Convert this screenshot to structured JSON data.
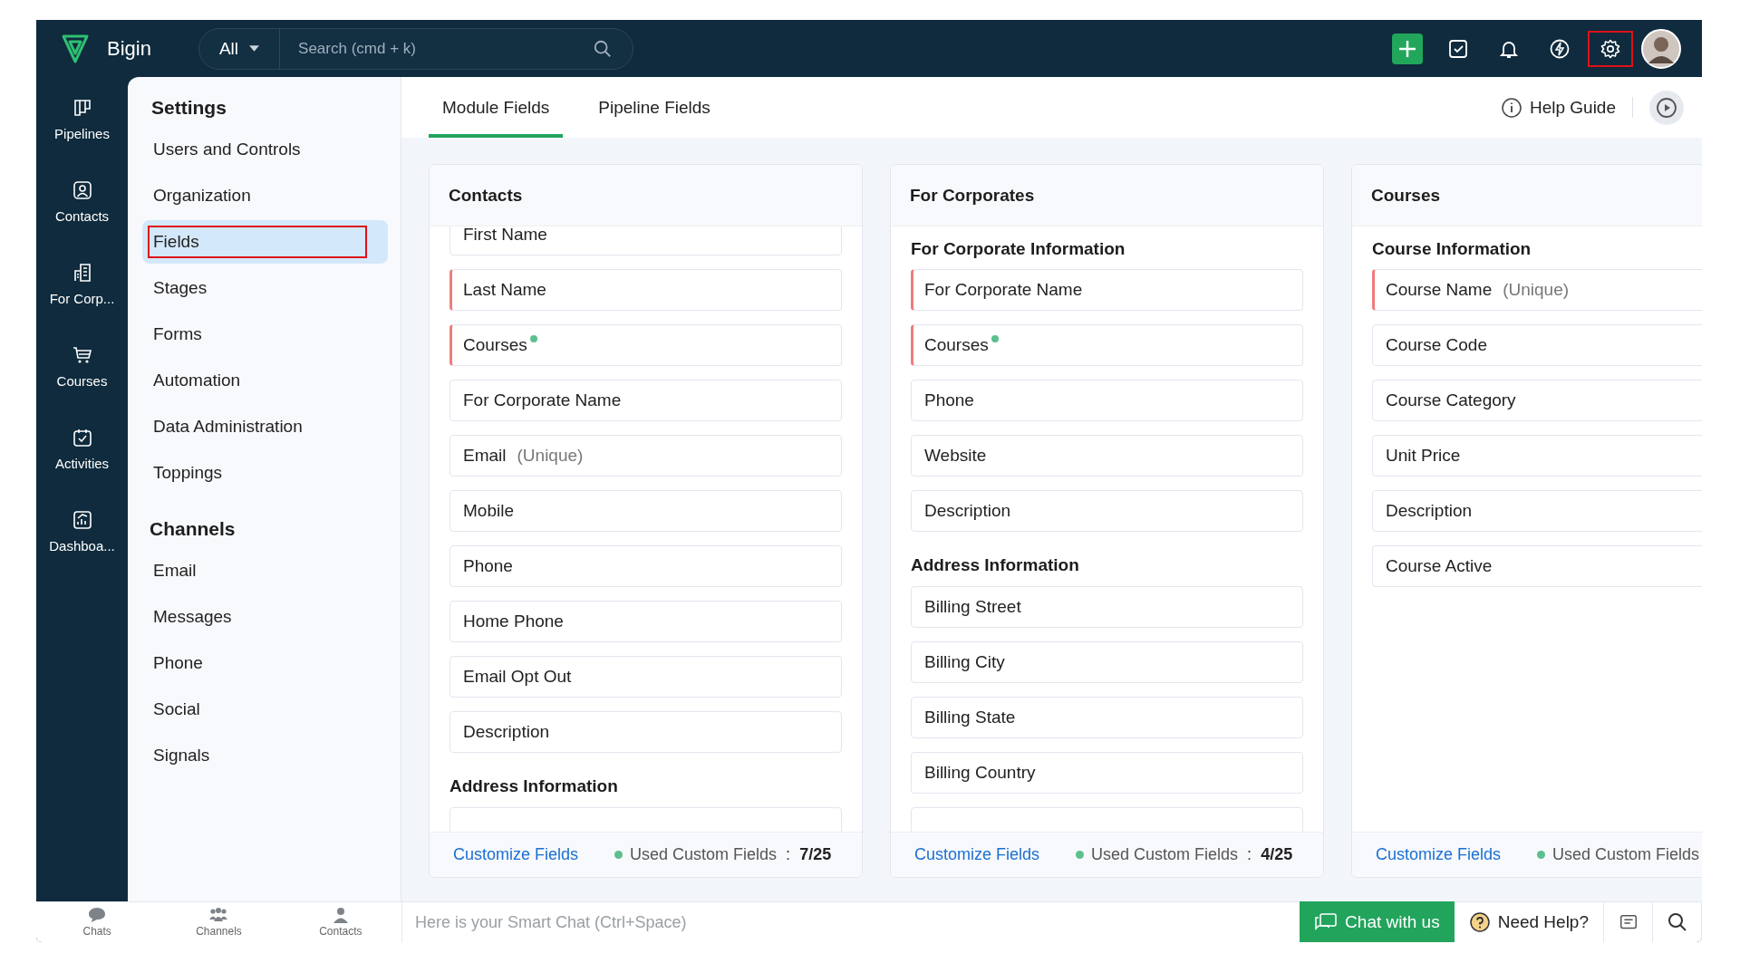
{
  "app": {
    "name": "Bigin"
  },
  "search": {
    "scope": "All",
    "placeholder": "Search (cmd + k)"
  },
  "toolbar": [
    {
      "kind": "add",
      "highlighted": false
    },
    {
      "kind": "tasks",
      "highlighted": false
    },
    {
      "kind": "notifications",
      "highlighted": false
    },
    {
      "kind": "signals",
      "highlighted": false
    },
    {
      "kind": "settings",
      "highlighted": true
    },
    {
      "kind": "avatar",
      "highlighted": false
    }
  ],
  "nav": [
    {
      "kind": "pipelines",
      "label": "Pipelines"
    },
    {
      "kind": "contacts",
      "label": "Contacts"
    },
    {
      "kind": "company",
      "label": "For Corp..."
    },
    {
      "kind": "cart",
      "label": "Courses"
    },
    {
      "kind": "activities",
      "label": "Activities"
    },
    {
      "kind": "dashboard",
      "label": "Dashboa..."
    }
  ],
  "settings": [
    {
      "title": "Settings",
      "items": [
        {
          "label": "Users and Controls",
          "selected": false,
          "highlighted": false
        },
        {
          "label": "Organization",
          "selected": false,
          "highlighted": false
        },
        {
          "label": "Fields",
          "selected": true,
          "highlighted": true
        },
        {
          "label": "Stages",
          "selected": false,
          "highlighted": false
        },
        {
          "label": "Forms",
          "selected": false,
          "highlighted": false
        },
        {
          "label": "Automation",
          "selected": false,
          "highlighted": false
        },
        {
          "label": "Data Administration",
          "selected": false,
          "highlighted": false
        },
        {
          "label": "Toppings",
          "selected": false,
          "highlighted": false
        }
      ]
    },
    {
      "title": "Channels",
      "items": [
        {
          "label": "Email",
          "selected": false,
          "highlighted": false
        },
        {
          "label": "Messages",
          "selected": false,
          "highlighted": false
        },
        {
          "label": "Phone",
          "selected": false,
          "highlighted": false
        },
        {
          "label": "Social",
          "selected": false,
          "highlighted": false
        },
        {
          "label": "Signals",
          "selected": false,
          "highlighted": false
        }
      ]
    }
  ],
  "tabs": [
    {
      "label": "Module Fields",
      "selected": true
    },
    {
      "label": "Pipeline Fields",
      "selected": false
    }
  ],
  "help_guide": "Help Guide",
  "modules": [
    {
      "title": "Contacts",
      "scrolled": true,
      "customize": "Customize Fields",
      "used_label": "Used Custom Fields",
      "used_separator": ":",
      "used_count": "7/25",
      "items": [
        {
          "kind": "field",
          "label": "First Name",
          "required": false,
          "lookup": false
        },
        {
          "kind": "field",
          "label": "Last Name",
          "required": true,
          "lookup": false
        },
        {
          "kind": "field",
          "label": "Courses",
          "required": true,
          "lookup": true
        },
        {
          "kind": "field",
          "label": "For Corporate Name",
          "required": false,
          "lookup": false
        },
        {
          "kind": "field",
          "label": "Email",
          "note": "(Unique)",
          "required": false,
          "lookup": false
        },
        {
          "kind": "field",
          "label": "Mobile",
          "required": false,
          "lookup": false
        },
        {
          "kind": "field",
          "label": "Phone",
          "required": false,
          "lookup": false
        },
        {
          "kind": "field",
          "label": "Home Phone",
          "required": false,
          "lookup": false
        },
        {
          "kind": "field",
          "label": "Email Opt Out",
          "required": false,
          "lookup": false
        },
        {
          "kind": "field",
          "label": "Description",
          "required": false,
          "lookup": false
        },
        {
          "kind": "section",
          "label": "Address Information"
        },
        {
          "kind": "cut"
        }
      ]
    },
    {
      "title": "For Corporates",
      "scrolled": false,
      "customize": "Customize Fields",
      "used_label": "Used Custom Fields",
      "used_separator": ":",
      "used_count": "4/25",
      "items": [
        {
          "kind": "section",
          "label": "For Corporate Information"
        },
        {
          "kind": "field",
          "label": "For Corporate Name",
          "required": true,
          "lookup": false
        },
        {
          "kind": "field",
          "label": "Courses",
          "required": true,
          "lookup": true
        },
        {
          "kind": "field",
          "label": "Phone",
          "required": false,
          "lookup": false
        },
        {
          "kind": "field",
          "label": "Website",
          "required": false,
          "lookup": false
        },
        {
          "kind": "field",
          "label": "Description",
          "required": false,
          "lookup": false
        },
        {
          "kind": "section",
          "label": "Address Information"
        },
        {
          "kind": "field",
          "label": "Billing Street",
          "required": false,
          "lookup": false
        },
        {
          "kind": "field",
          "label": "Billing City",
          "required": false,
          "lookup": false
        },
        {
          "kind": "field",
          "label": "Billing State",
          "required": false,
          "lookup": false
        },
        {
          "kind": "field",
          "label": "Billing Country",
          "required": false,
          "lookup": false
        },
        {
          "kind": "cut"
        }
      ]
    },
    {
      "title": "Courses",
      "scrolled": false,
      "customize": "Customize Fields",
      "used_label": "Used Custom Fields",
      "items": [
        {
          "kind": "section",
          "label": "Course Information"
        },
        {
          "kind": "field",
          "label": "Course Name",
          "note": "(Unique)",
          "required": true,
          "lookup": false
        },
        {
          "kind": "field",
          "label": "Course Code",
          "required": false,
          "lookup": false
        },
        {
          "kind": "field",
          "label": "Course Category",
          "required": false,
          "lookup": false
        },
        {
          "kind": "field",
          "label": "Unit Price",
          "required": false,
          "lookup": false
        },
        {
          "kind": "field",
          "label": "Description",
          "required": false,
          "lookup": false
        },
        {
          "kind": "field",
          "label": "Course Active",
          "required": false,
          "lookup": false
        }
      ]
    }
  ],
  "bottom_tabs": [
    {
      "kind": "chats",
      "label": "Chats"
    },
    {
      "kind": "channels",
      "label": "Channels"
    },
    {
      "kind": "contacts",
      "label": "Contacts"
    }
  ],
  "smart_chat": {
    "placeholder": "Here is your Smart Chat (Ctrl+Space)"
  },
  "chat_button": "Chat with us",
  "need_help": "Need Help?"
}
